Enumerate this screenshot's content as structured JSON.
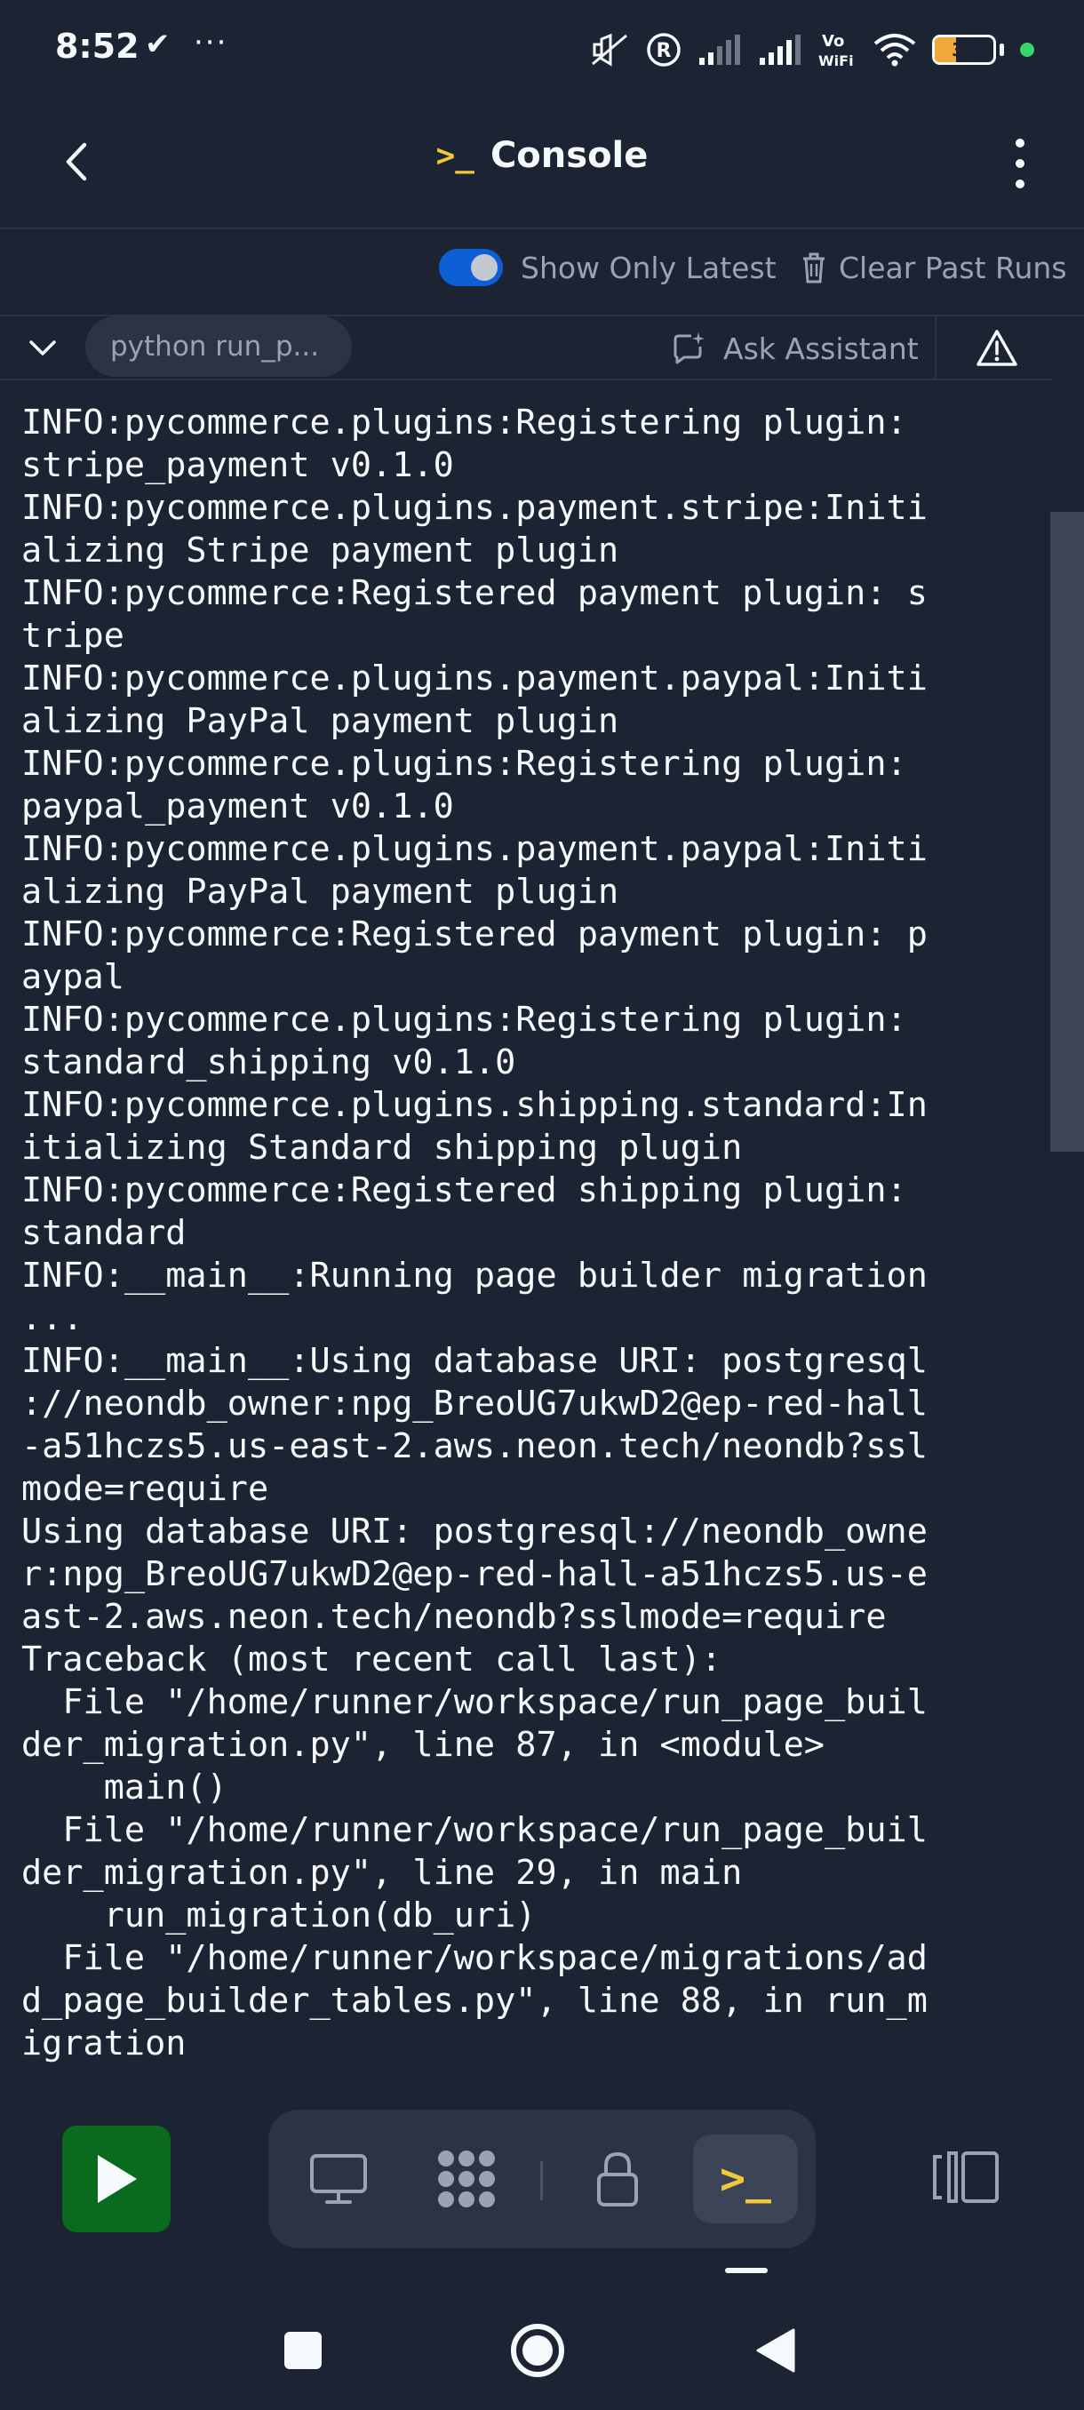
{
  "status_bar": {
    "time": "8:52",
    "check": "✔",
    "more": "···",
    "battery": "36",
    "icons": [
      "mute-icon",
      "r-circle-icon",
      "signal-icon",
      "signal-icon",
      "vowifi-icon",
      "wifi-icon",
      "battery-icon"
    ],
    "vowifi": "Vo\nWiFi"
  },
  "header": {
    "title": "Console",
    "console_glyph": ">_"
  },
  "toolbar": {
    "toggle_label": "Show Only Latest",
    "toggle_on": true,
    "clear_label": "Clear Past Runs"
  },
  "tabs": {
    "run_label": "python run_p...",
    "ask_label": "Ask Assistant"
  },
  "console": {
    "output": "INFO:pycommerce.plugins:Registering plugin:\nstripe_payment v0.1.0\nINFO:pycommerce.plugins.payment.stripe:Initi\nalizing Stripe payment plugin\nINFO:pycommerce:Registered payment plugin: s\ntripe\nINFO:pycommerce.plugins.payment.paypal:Initi\nalizing PayPal payment plugin\nINFO:pycommerce.plugins:Registering plugin:\npaypal_payment v0.1.0\nINFO:pycommerce.plugins.payment.paypal:Initi\nalizing PayPal payment plugin\nINFO:pycommerce:Registered payment plugin: p\naypal\nINFO:pycommerce.plugins:Registering plugin:\nstandard_shipping v0.1.0\nINFO:pycommerce.plugins.shipping.standard:In\nitializing Standard shipping plugin\nINFO:pycommerce:Registered shipping plugin:\nstandard\nINFO:__main__:Running page builder migration\n...\nINFO:__main__:Using database URI: postgresql\n://neondb_owner:npg_BreoUG7ukwD2@ep-red-hall\n-a51hczs5.us-east-2.aws.neon.tech/neondb?ssl\nmode=require\nUsing database URI: postgresql://neondb_owne\nr:npg_BreoUG7ukwD2@ep-red-hall-a51hczs5.us-e\nast-2.aws.neon.tech/neondb?sslmode=require\nTraceback (most recent call last):\n  File \"/home/runner/workspace/run_page_buil\nder_migration.py\", line 87, in <module>\n    main()\n  File \"/home/runner/workspace/run_page_buil\nder_migration.py\", line 29, in main\n    run_migration(db_uri)\n  File \"/home/runner/workspace/migrations/ad\nd_page_builder_tables.py\", line 88, in run_m\nigration"
  },
  "bottom_toolbar": {
    "tools": [
      "desktop-icon",
      "apps-icon",
      "lock-icon",
      "console-icon"
    ],
    "active_tool": "console-icon",
    "console_glyph": ">_"
  },
  "colors": {
    "background": "#1c2333",
    "surface": "#2b3445",
    "accent_yellow": "#f2c83b",
    "toggle_blue": "#0d5fd6",
    "run_green": "#0a6b1f",
    "muted_text": "#9aa3b2"
  }
}
